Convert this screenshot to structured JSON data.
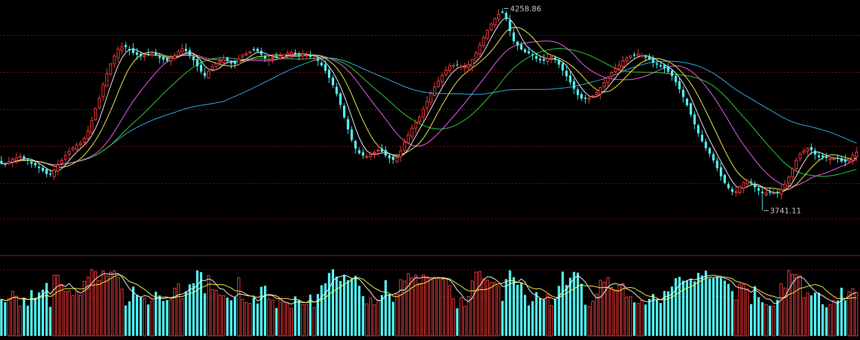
{
  "chart_data": {
    "type": "candlestick",
    "colors": {
      "background": "#000000",
      "up": "#ff3b3b",
      "down": "#54fcfc",
      "grid": "#8b1010",
      "separator": "#b01515",
      "ma5": "#ffffff",
      "ma10": "#ffff4d",
      "ma20": "#ff66ff",
      "ma30": "#33dd33",
      "ma60": "#33bbee",
      "label": "#cccccc"
    },
    "price": {
      "ylim": [
        3700,
        4270
      ],
      "gridlines": [
        4190,
        4095,
        4000,
        3905,
        3810,
        3720
      ],
      "max_label": "4258.86",
      "min_label": "3741.11",
      "max_value": 4258.86,
      "min_value": 3741.11
    },
    "volume_ma_colors": [
      "#ffffff",
      "#ffff4d"
    ],
    "close_series": [
      3862,
      3859,
      3866,
      3873,
      3876,
      3880,
      3875,
      3869,
      3861,
      3857,
      3850,
      3843,
      3835,
      3833,
      3846,
      3858,
      3870,
      3882,
      3893,
      3902,
      3909,
      3914,
      3926,
      3945,
      3972,
      4002,
      4029,
      4064,
      4092,
      4117,
      4137,
      4155,
      4161,
      4160,
      4152,
      4145,
      4140,
      4136,
      4138,
      4141,
      4143,
      4139,
      4132,
      4128,
      4125,
      4131,
      4139,
      4149,
      4156,
      4150,
      4138,
      4126,
      4111,
      4097,
      4086,
      4098,
      4109,
      4118,
      4124,
      4128,
      4125,
      4118,
      4117,
      4130,
      4140,
      4143,
      4148,
      4152,
      4149,
      4141,
      4131,
      4128,
      4134,
      4133,
      4137,
      4140,
      4145,
      4146,
      4141,
      4140,
      4142,
      4139,
      4135,
      4132,
      4125,
      4113,
      4099,
      4081,
      4062,
      4040,
      4012,
      3980,
      3949,
      3922,
      3900,
      3888,
      3882,
      3880,
      3885,
      3890,
      3896,
      3892,
      3882,
      3875,
      3871,
      3876,
      3894,
      3916,
      3935,
      3952,
      3966,
      3980,
      4001,
      4021,
      4041,
      4058,
      4073,
      4088,
      4101,
      4112,
      4113,
      4113,
      4111,
      4109,
      4115,
      4128,
      4145,
      4165,
      4185,
      4203,
      4219,
      4233,
      4244,
      4248,
      4232,
      4201,
      4175,
      4164,
      4154,
      4147,
      4144,
      4139,
      4130,
      4126,
      4125,
      4130,
      4135,
      4128,
      4115,
      4100,
      4085,
      4070,
      4053,
      4037,
      4028,
      4027,
      4030,
      4035,
      4044,
      4056,
      4069,
      4082,
      4095,
      4105,
      4114,
      4125,
      4132,
      4137,
      4138,
      4142,
      4139,
      4133,
      4128,
      4120,
      4115,
      4110,
      4105,
      4097,
      4086,
      4070,
      4052,
      4032,
      4011,
      3987,
      3962,
      3939,
      3919,
      3901,
      3887,
      3870,
      3850,
      3829,
      3812,
      3799,
      3789,
      3790,
      3802,
      3813,
      3818,
      3813,
      3801,
      3792,
      3786,
      3786,
      3787,
      3786,
      3786,
      3795,
      3809,
      3827,
      3848,
      3870,
      3886,
      3894,
      3900,
      3896,
      3885,
      3878,
      3878,
      3876,
      3874,
      3874,
      3874,
      3867,
      3866,
      3873,
      3883,
      3891
    ]
  }
}
